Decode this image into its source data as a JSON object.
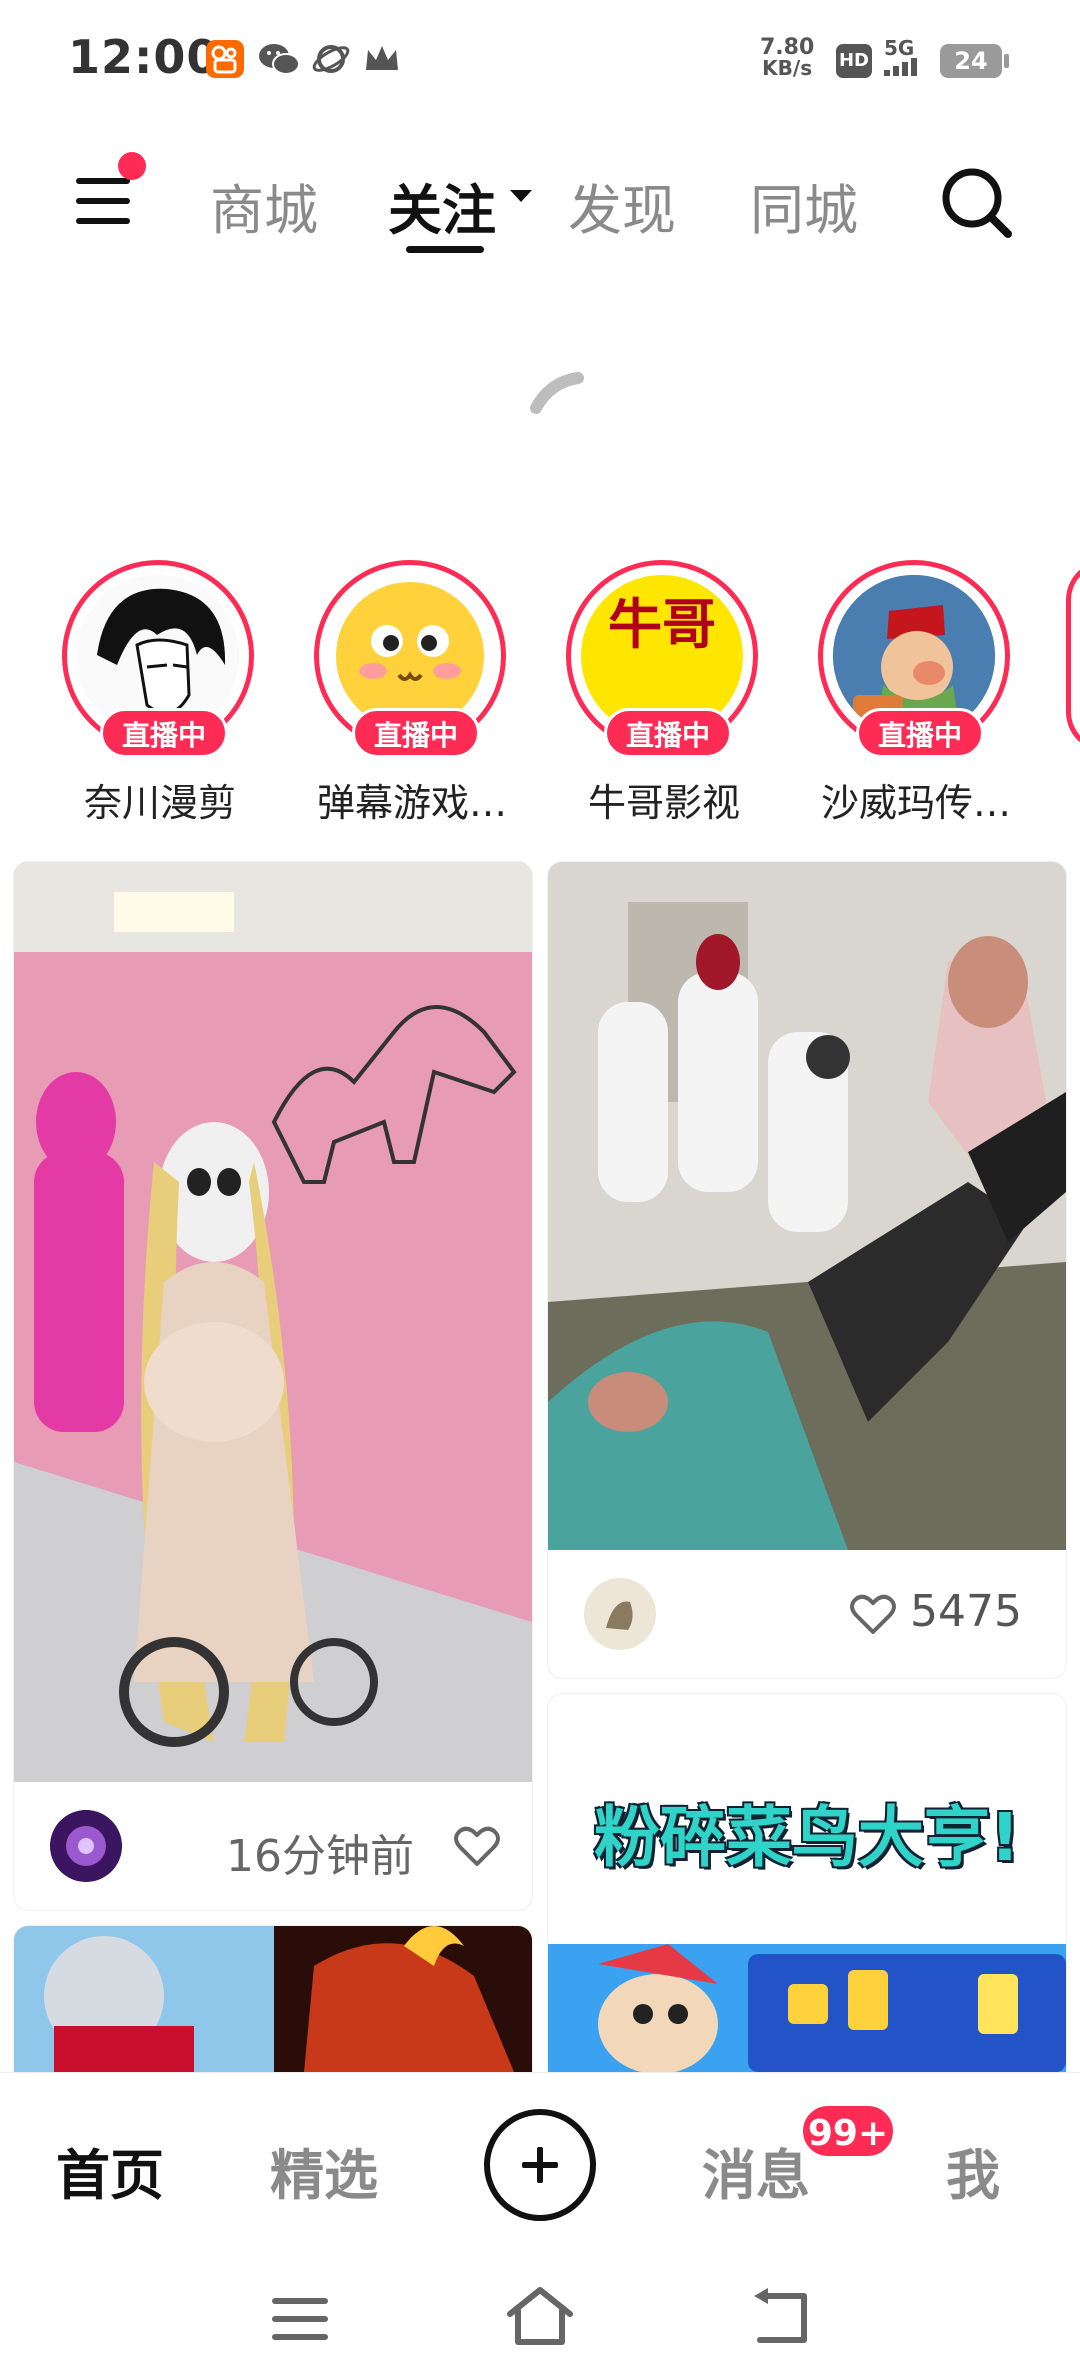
{
  "status_bar": {
    "time": "12:00",
    "net_speed_value": "7.80",
    "net_speed_unit": "KB/s",
    "hd": "HD",
    "signal": "5G",
    "battery": "24",
    "icons": [
      "kuaishou-app-icon",
      "wechat-icon",
      "planet-icon",
      "crown-icon"
    ]
  },
  "top_nav": {
    "tabs": [
      {
        "label": "商城"
      },
      {
        "label": "关注"
      },
      {
        "label": "发现"
      },
      {
        "label": "同城"
      }
    ],
    "active_tab": "关注"
  },
  "stories": [
    {
      "name": "奈川漫剪",
      "badge": "直播中"
    },
    {
      "name": "弹幕游戏…",
      "badge": "直播中"
    },
    {
      "name": "牛哥影视",
      "badge": "直播中",
      "avatar_text": "牛哥"
    },
    {
      "name": "沙威玛传…",
      "badge": "直播中"
    }
  ],
  "feed": {
    "card1": {
      "meta": "16分钟前"
    },
    "card2": {
      "likes": "5475"
    },
    "card4": {
      "title_text": "粉碎菜鸟大亨!"
    }
  },
  "bottom_bar": {
    "tabs": [
      {
        "label": "首页"
      },
      {
        "label": "精选"
      },
      {
        "label": "消息"
      },
      {
        "label": "我"
      }
    ],
    "message_badge": "99+"
  },
  "colors": {
    "accent": "#fe2c55",
    "active_text": "#111111",
    "inactive_text": "#8a8a8a"
  }
}
